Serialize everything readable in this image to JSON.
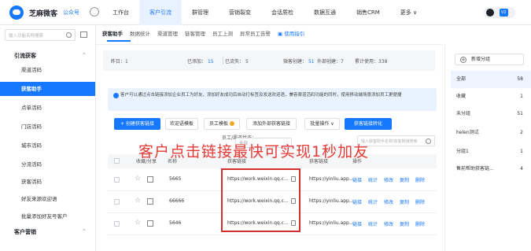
{
  "topbar": {
    "brand": "芝麻微客",
    "account": "公众号",
    "nav": [
      {
        "label": "工作台",
        "active": false
      },
      {
        "label": "客户引流",
        "active": true
      },
      {
        "label": "群管理",
        "active": false
      },
      {
        "label": "营销裂变",
        "active": false
      },
      {
        "label": "会话质检",
        "active": false
      },
      {
        "label": "数据互通",
        "active": false
      },
      {
        "label": "销售CRM",
        "active": false
      },
      {
        "label": "更多 ∨",
        "active": false
      }
    ],
    "user_tag": "V2"
  },
  "sidebar": {
    "search_placeholder": "输入功能名称搜索",
    "group1": "引流获客",
    "items": [
      "渠道活码",
      "获客助手",
      "点单活码",
      "门店活码",
      "城市活码",
      "分流活码",
      "获客活码",
      "好友来源欢迎语",
      "批量添加好友号客户"
    ],
    "active_index": 1,
    "group2": "客户营销"
  },
  "subtabs": {
    "items": [
      "获客助手",
      "数据统计",
      "渠道管理",
      "链客管理",
      "员工上测",
      "异常员工告警"
    ],
    "help": "使用指引"
  },
  "stats": {
    "yesterday_label": "昨日：1",
    "added_label": "已添加：",
    "added_value": "15",
    "lost_label": "已流失：",
    "lost_value": "5",
    "created_label": "微客创建：",
    "created_value": "51",
    "external_label": "外部创建：7",
    "total_label": "累计使用：338"
  },
  "notice": {
    "text": "客户可以通过点击链接添加企业员工为好友，添加好友成功后自动打标签及发送欢迎语，兼容渠道活码功能的同时，使用移动端场景添加员工更便捷"
  },
  "toolbar": {
    "create": "+ 创建获客链接",
    "welcome": "欢迎语模板",
    "staff_template": "员工模板",
    "external": "添加外部获客链接",
    "batch": "批量操作 ∨",
    "convert": "获客链接转化"
  },
  "filter": {
    "label": "员工/渠道状态：",
    "select_value": "全部",
    "search_placeholder": "输入获客助手名称/获客链接搜索"
  },
  "table": {
    "headers": [
      "收藏/分享",
      "名称",
      "获客链接",
      "获客链接",
      "操作"
    ],
    "rows": [
      {
        "name": "5665",
        "link": "https://work.weixin.qq.c...",
        "link2": "https://yinliu.app..."
      },
      {
        "name": "66666",
        "link": "https://work.weixin.qq.c...",
        "link2": "https://yinliu.app..."
      },
      {
        "name": "5646",
        "link": "https://work.weixin.qq.c...",
        "link2": "https://yinliu.app..."
      }
    ],
    "actions": [
      "链接",
      "统计",
      "修改",
      "复制",
      "删除"
    ]
  },
  "overlay": {
    "caption": "客户点击链接最快可实现1秒加友"
  },
  "groups": {
    "new_label": "新增分组",
    "items": [
      {
        "label": "全部",
        "count": "58",
        "active": true
      },
      {
        "label": "收藏",
        "count": "1",
        "active": false
      },
      {
        "label": "未分组",
        "count": "51",
        "active": false
      },
      {
        "label": "helen测试",
        "count": "2",
        "active": false
      },
      {
        "label": "分组1",
        "count": "1",
        "active": false
      },
      {
        "label": "售前帮助获客链...",
        "count": "4",
        "active": false
      }
    ]
  },
  "colors": {
    "accent": "#1677ff",
    "highlight": "#d32f2f"
  }
}
